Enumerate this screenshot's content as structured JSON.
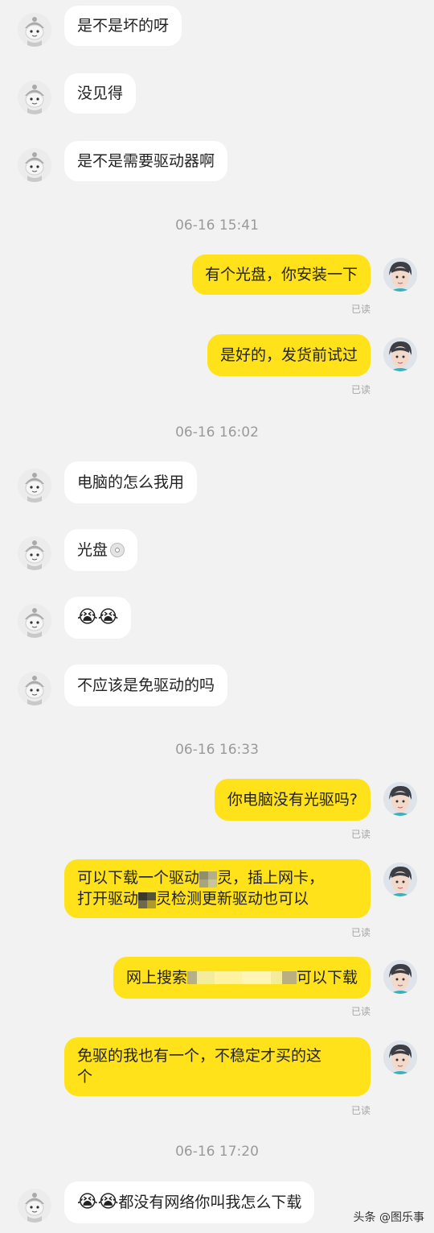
{
  "messages": [
    {
      "side": "left",
      "text": "是不是坏的呀"
    },
    {
      "side": "left",
      "text": "没见得"
    },
    {
      "side": "left",
      "text": "是不是需要驱动器啊"
    },
    {
      "type": "time",
      "text": "06-16 15:41"
    },
    {
      "side": "right",
      "text": "有个光盘，你安装一下",
      "read": "已读"
    },
    {
      "side": "right",
      "text": "是好的，发货前试过",
      "read": "已读"
    },
    {
      "type": "time",
      "text": "06-16 16:02"
    },
    {
      "side": "left",
      "text": "电脑的怎么我用"
    },
    {
      "side": "left",
      "text": "光盘",
      "icon": "cd-disc-icon"
    },
    {
      "side": "left",
      "emoji": "😭😭"
    },
    {
      "side": "left",
      "text": "不应该是免驱动的吗"
    },
    {
      "type": "time",
      "text": "06-16 16:33"
    },
    {
      "side": "right",
      "text": "你电脑没有光驱吗?",
      "read": "已读"
    },
    {
      "side": "right",
      "line1_a": "可以下载一个驱动",
      "line1_b": "灵，插上网卡，",
      "line2_a": "打开驱动",
      "line2_b": "灵检测更新驱动也可以",
      "read": "已读"
    },
    {
      "side": "right",
      "text_a": "网上搜索",
      "text_b": "可以下载",
      "read": "已读"
    },
    {
      "side": "right",
      "line1": "免驱的我也有一个，不稳定才买的这",
      "line2": "个",
      "read": "已读"
    },
    {
      "type": "time",
      "text": "06-16 17:20"
    },
    {
      "side": "left",
      "emoji": "😭😭",
      "text": "都没有网络你叫我怎么下载"
    }
  ],
  "watermark": "头条 @图乐事"
}
